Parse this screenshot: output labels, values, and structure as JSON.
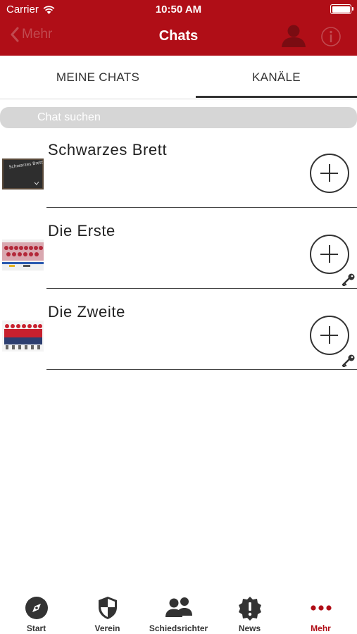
{
  "status_bar": {
    "carrier": "Carrier",
    "time": "10:50 AM"
  },
  "nav": {
    "back_label": "Mehr",
    "title": "Chats"
  },
  "tabs": [
    {
      "label": "MEINE CHATS"
    },
    {
      "label": "KANÄLE",
      "active": true
    }
  ],
  "search": {
    "placeholder": "Chat suchen"
  },
  "chats": [
    {
      "title": "Schwarzes Brett",
      "thumbnail_text": "Schwarzes Brett",
      "locked": false
    },
    {
      "title": "Die Erste",
      "locked": true
    },
    {
      "title": "Die Zweite",
      "locked": true
    }
  ],
  "tabbar": [
    {
      "label": "Start",
      "icon": "compass-icon"
    },
    {
      "label": "Verein",
      "icon": "shield-icon"
    },
    {
      "label": "Schiedsrichter",
      "icon": "people-icon"
    },
    {
      "label": "News",
      "icon": "news-badge-icon"
    },
    {
      "label": "Mehr",
      "icon": "more-dots-icon",
      "active": true
    }
  ],
  "colors": {
    "brand": "#b00e17",
    "text": "#333333",
    "search_bg": "#d6d6d6"
  }
}
